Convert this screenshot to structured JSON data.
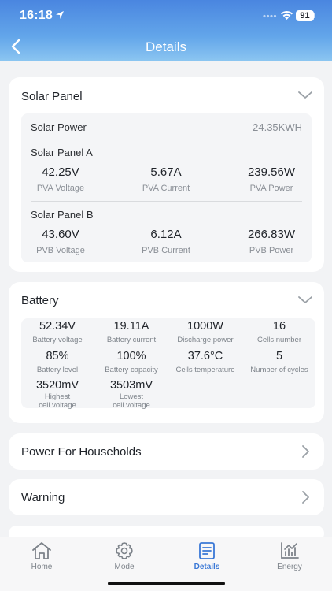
{
  "status": {
    "time": "16:18",
    "battery": "91"
  },
  "header": {
    "title": "Details"
  },
  "solar": {
    "title": "Solar Panel",
    "power_label": "Solar Power",
    "power_value": "24.35KWH",
    "panel_a": {
      "title": "Solar Panel A",
      "metrics": [
        {
          "value": "42.25V",
          "label": "PVA Voltage"
        },
        {
          "value": "5.67A",
          "label": "PVA Current"
        },
        {
          "value": "239.56W",
          "label": "PVA Power"
        }
      ]
    },
    "panel_b": {
      "title": "Solar Panel B",
      "metrics": [
        {
          "value": "43.60V",
          "label": "PVB Voltage"
        },
        {
          "value": "6.12A",
          "label": "PVB Current"
        },
        {
          "value": "266.83W",
          "label": "PVB Power"
        }
      ]
    }
  },
  "battery": {
    "title": "Battery",
    "metrics": [
      {
        "value": "52.34V",
        "label": "Battery voltage"
      },
      {
        "value": "19.11A",
        "label": "Battery current"
      },
      {
        "value": "1000W",
        "label": "Discharge power"
      },
      {
        "value": "16",
        "label": "Cells number"
      },
      {
        "value": "85%",
        "label": "Battery level"
      },
      {
        "value": "100%",
        "label": "Battery capacity"
      },
      {
        "value": "37.6°C",
        "label": "Cells temperature"
      },
      {
        "value": "5",
        "label": "Number of cycles"
      },
      {
        "value": "3520mV",
        "label": "Highest\ncell voltage"
      },
      {
        "value": "3503mV",
        "label": "Lowest\ncell voltage"
      }
    ]
  },
  "sections": [
    {
      "label": "Power For Households"
    },
    {
      "label": "Warning"
    }
  ],
  "tabs": [
    {
      "label": "Home",
      "icon": "home-icon"
    },
    {
      "label": "Mode",
      "icon": "gear-icon"
    },
    {
      "label": "Details",
      "icon": "document-icon",
      "active": true
    },
    {
      "label": "Energy",
      "icon": "chart-icon"
    }
  ],
  "colors": {
    "accent": "#3a78d6",
    "header_top": "#4a86e0",
    "header_bottom": "#8cc6f1"
  }
}
